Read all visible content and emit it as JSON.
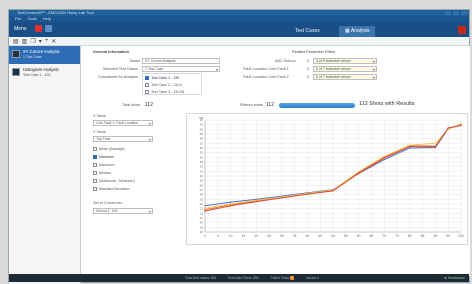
{
  "window": {
    "title": "TestCenter48™ - EMCHON Relay Lab Tool"
  },
  "menubar": {
    "items": [
      "File",
      "Tools",
      "Help"
    ]
  },
  "ribbon": {
    "menu_label": "Menu",
    "tabs": [
      "Test Cases",
      "Analysis"
    ],
    "active_tab": "Analysis"
  },
  "sidebar": {
    "items": [
      {
        "label": "XY Curves Analysis",
        "sub": "1 Test Case"
      },
      {
        "label": "Histogram Analysis",
        "sub": "Test Case 1 - 139"
      }
    ]
  },
  "general": {
    "title": "General Information",
    "name_label": "Name",
    "name_value": "XY Curves Analysis",
    "selected_label": "Selected Test Cases",
    "selected_value": "1 Test Case",
    "considered_label": "Considered for Analysis",
    "cases": [
      {
        "label": "Test Case 1 - 139",
        "checked": true
      },
      {
        "label": "Test Case 2 - 13U4",
        "checked": false
      },
      {
        "label": "Test Case 3 - 13U2N",
        "checked": false
      }
    ],
    "total_label": "Total shots",
    "total_value": "112",
    "filtered_label": "Filtered shots",
    "filtered_value": "112",
    "shots_result": "112 Shots with Results",
    "progress": 1.0
  },
  "filters": {
    "title": "Related Parameter Filters",
    "rows": [
      {
        "label": "ABC School",
        "badge": "1",
        "value": "4 of 6 available values"
      },
      {
        "label": "Fault Location, Line Fault 1",
        "badge": "1",
        "value": "2 of 7 available values"
      },
      {
        "label": "Fault Location, Line Fault 2",
        "badge": "1",
        "value": "2 of 7 available values"
      }
    ]
  },
  "axes_panel": {
    "x_label": "X Value",
    "x_value": "Line Fault 1: Fault Location",
    "y_label": "Y Value",
    "y_value": "Trip Time",
    "options": [
      {
        "label": "Mean (Average)",
        "checked": false
      },
      {
        "label": "Minimum",
        "checked": true
      },
      {
        "label": "Maximum",
        "checked": false
      },
      {
        "label": "Median",
        "checked": false
      },
      {
        "label": "(Maximum - Minimum)",
        "checked": false
      },
      {
        "label": "Standard Deviation",
        "checked": false
      }
    ],
    "curves_label": "Set of Curves for...",
    "curves_value": "School 1: 100"
  },
  "chart_data": {
    "type": "line",
    "xlabel": "",
    "ylabel": "ms",
    "xlim": [
      0,
      100
    ],
    "ylim": [
      18,
      42
    ],
    "x_ticks": [
      0,
      5,
      10,
      15,
      20,
      25,
      30,
      35,
      40,
      45,
      50,
      55,
      60,
      65,
      70,
      75,
      80,
      85,
      90,
      95,
      100
    ],
    "y_ticks": [
      18,
      19,
      20,
      21,
      22,
      23,
      24,
      25,
      26,
      27,
      28,
      29,
      30,
      31,
      32,
      33,
      34,
      35,
      36,
      37,
      38,
      39,
      40,
      41,
      42
    ],
    "series": [
      {
        "color": "#3b6fd4",
        "x": [
          0,
          10,
          20,
          30,
          40,
          50,
          60,
          70,
          80,
          90,
          95,
          100
        ],
        "y": [
          23.6,
          24.4,
          25.0,
          25.7,
          26.4,
          27.1,
          30.5,
          33.5,
          36.0,
          36.1,
          40.1,
          41.0
        ]
      },
      {
        "color": "#e8742a",
        "x": [
          0,
          10,
          20,
          30,
          40,
          50,
          60,
          70,
          80,
          90,
          95,
          100
        ],
        "y": [
          22.8,
          23.8,
          24.6,
          25.4,
          26.2,
          26.9,
          30.8,
          34.0,
          36.5,
          36.4,
          40.2,
          41.1
        ]
      },
      {
        "color": "#f2c14e",
        "x": [
          0,
          10,
          20,
          30,
          40,
          50,
          60,
          70,
          80,
          90,
          95,
          100
        ],
        "y": [
          23.1,
          24.0,
          24.8,
          25.5,
          26.3,
          27.0,
          30.9,
          34.2,
          36.6,
          37.0,
          40.0,
          41.2
        ]
      },
      {
        "color": "#e0413a",
        "x": [
          0,
          10,
          20,
          30,
          40,
          50,
          60,
          70,
          80,
          90,
          95,
          100
        ],
        "y": [
          22.5,
          23.6,
          24.5,
          25.3,
          26.1,
          26.8,
          30.6,
          33.8,
          36.3,
          36.2,
          40.3,
          40.8
        ]
      }
    ]
  },
  "statusbar": {
    "items": [
      {
        "label": "Total test cases",
        "value": "288"
      },
      {
        "label": "Executed Tests",
        "value": "288"
      },
      {
        "label": "Failed Tests",
        "value": "0"
      },
      {
        "label": "Issues",
        "value": "0"
      }
    ],
    "hardware": "Hardware"
  },
  "colors": {
    "accent": "#2e6db6",
    "ribbon": "#1a4e86"
  }
}
